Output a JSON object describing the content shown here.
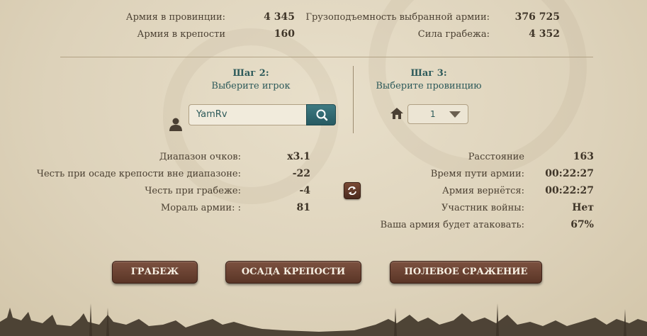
{
  "top_stats": {
    "army_province_label": "Армия в провинции:",
    "army_province_value": "4 345",
    "army_fortress_label": "Армия в крепости",
    "army_fortress_value": "160",
    "capacity_label": "Грузоподъемность выбранной армии:",
    "capacity_value": "376 725",
    "plunder_label": "Сила грабежа:",
    "plunder_value": "4 352"
  },
  "step2": {
    "title": "Шаг 2:",
    "subtitle": "Выберите игрок",
    "player_value": "YamRv"
  },
  "step3": {
    "title": "Шаг 3:",
    "subtitle": "Выберите провинцию",
    "province_selected": "1"
  },
  "left_stats": [
    {
      "label": "Диапазон очков:",
      "value": "x3.1"
    },
    {
      "label": "Честь при осаде крепости вне диапазоне:",
      "value": "-22"
    },
    {
      "label": "Честь при грабеже:",
      "value": "-4"
    },
    {
      "label": "Мораль армии: :",
      "value": "81"
    }
  ],
  "right_stats": [
    {
      "label": "Расстояние",
      "value": "163"
    },
    {
      "label": "Время пути армии:",
      "value": "00:22:27"
    },
    {
      "label": "Армия вернётся:",
      "value": "00:22:27"
    },
    {
      "label": "Участник войны:",
      "value": "Нет"
    },
    {
      "label": "Ваша армия будет атаковать:",
      "value": "67%"
    }
  ],
  "buttons": {
    "plunder": "ГРАБЕЖ",
    "siege": "ОСАДА КРЕПОСТИ",
    "field_battle": "ПОЛЕВОЕ СРАЖЕНИЕ"
  },
  "icons": {
    "search": "search-icon",
    "person": "person-icon",
    "house": "house-icon",
    "swap": "swap-icon",
    "dropdown": "chevron-down-icon"
  },
  "colors": {
    "accent_teal": "#2d5a5a",
    "button_brown": "#5a3526",
    "background": "#ddd2ba"
  }
}
